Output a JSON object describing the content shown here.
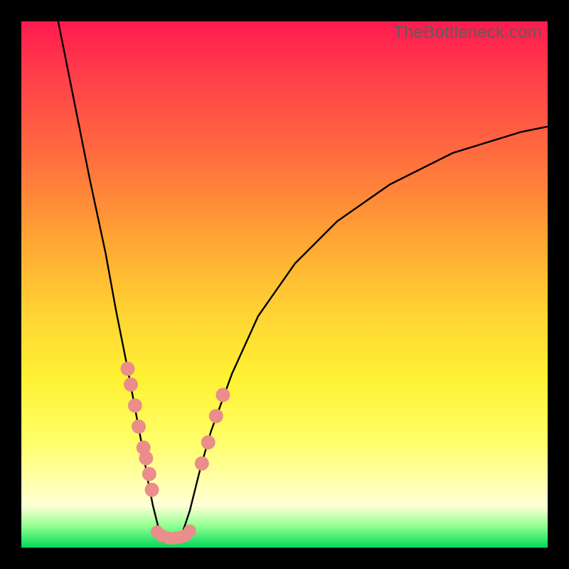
{
  "watermark": "TheBottleneck.com",
  "chart_data": {
    "type": "line",
    "title": "",
    "xlabel": "",
    "ylabel": "",
    "xlim": [
      0,
      100
    ],
    "ylim": [
      0,
      100
    ],
    "curve_left": {
      "name": "left-branch",
      "x": [
        7,
        10,
        13,
        16,
        18,
        20,
        21.5,
        23,
        24,
        25,
        26,
        27
      ],
      "y": [
        100,
        85,
        70,
        56,
        45,
        35,
        27,
        19,
        13,
        8,
        4,
        1
      ]
    },
    "curve_right": {
      "name": "right-branch",
      "x": [
        30,
        32,
        34,
        36,
        40,
        45,
        52,
        60,
        70,
        82,
        95,
        100
      ],
      "y": [
        1,
        7,
        15,
        22,
        33,
        44,
        54,
        62,
        69,
        75,
        79,
        80
      ]
    },
    "scatter_left": {
      "name": "left-dots",
      "color": "#eb8d8a",
      "points": [
        {
          "x": 20.2,
          "y": 34
        },
        {
          "x": 20.8,
          "y": 31
        },
        {
          "x": 21.6,
          "y": 27
        },
        {
          "x": 22.3,
          "y": 23
        },
        {
          "x": 23.2,
          "y": 19
        },
        {
          "x": 23.7,
          "y": 17
        },
        {
          "x": 24.3,
          "y": 14
        },
        {
          "x": 24.8,
          "y": 11
        }
      ]
    },
    "scatter_right": {
      "name": "right-dots",
      "color": "#eb8d8a",
      "points": [
        {
          "x": 34.3,
          "y": 16
        },
        {
          "x": 35.5,
          "y": 20
        },
        {
          "x": 37.0,
          "y": 25
        },
        {
          "x": 38.3,
          "y": 29
        }
      ]
    },
    "scatter_bottom": {
      "name": "bottom-dots",
      "color": "#eb8d8a",
      "points": [
        {
          "x": 25.8,
          "y": 3.0
        },
        {
          "x": 26.8,
          "y": 2.2
        },
        {
          "x": 28.0,
          "y": 1.8
        },
        {
          "x": 29.2,
          "y": 1.8
        },
        {
          "x": 30.3,
          "y": 2.0
        },
        {
          "x": 31.2,
          "y": 2.3
        },
        {
          "x": 32.0,
          "y": 3.2
        }
      ]
    }
  }
}
